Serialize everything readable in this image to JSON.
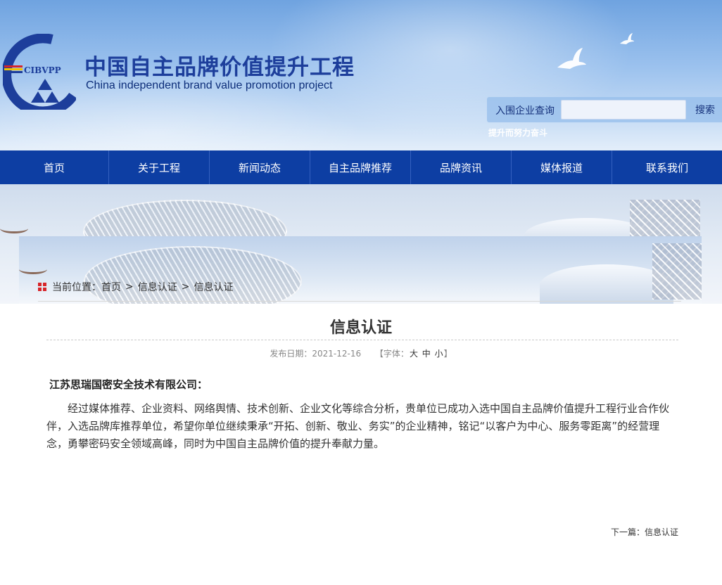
{
  "header": {
    "logo_text": "CIBVPP",
    "title_cn": "中国自主品牌价值提升工程",
    "title_en": "China independent brand value promotion project",
    "search_label": "入围企业查询",
    "search_placeholder": "",
    "search_button": "搜索",
    "slogan": "提升而努力奋斗",
    "icons": [
      "cibvpp-logo-icon",
      "dove-icon"
    ]
  },
  "nav": {
    "items": [
      {
        "label": "首页"
      },
      {
        "label": "关于工程"
      },
      {
        "label": "新闻动态"
      },
      {
        "label": "自主品牌推荐"
      },
      {
        "label": "品牌资讯"
      },
      {
        "label": "媒体报道"
      },
      {
        "label": "联系我们"
      }
    ]
  },
  "breadcrumb": {
    "prefix": "当前位置：",
    "items": [
      "首页",
      "信息认证",
      "信息认证"
    ],
    "separator": ">"
  },
  "article": {
    "title": "信息认证",
    "date_label": "发布日期：",
    "date": "2021-12-16",
    "font_label_open": "【字体：",
    "font_sizes": [
      "大",
      "中",
      "小"
    ],
    "font_label_close": "】",
    "recipient": "江苏思瑞国密安全技术有限公司：",
    "body": "经过媒体推荐、企业资料、网络舆情、技术创新、企业文化等综合分析，贵单位已成功入选中国自主品牌价值提升工程行业合作伙伴，入选品牌库推荐单位，希望你单位继续秉承“开拓、创新、敬业、务实”的企业精神，铭记“以客户为中心、服务零距离”的经营理念，勇攀密码安全领域高峰，同时为中国自主品牌价值的提升奉献力量。"
  },
  "footer_nav": {
    "next_label": "下一篇：",
    "next_title": "信息认证"
  },
  "colors": {
    "nav_bg": "#0d3ea3",
    "title_blue": "#1d3e9b",
    "breadcrumb_icon": "#d7252a"
  }
}
